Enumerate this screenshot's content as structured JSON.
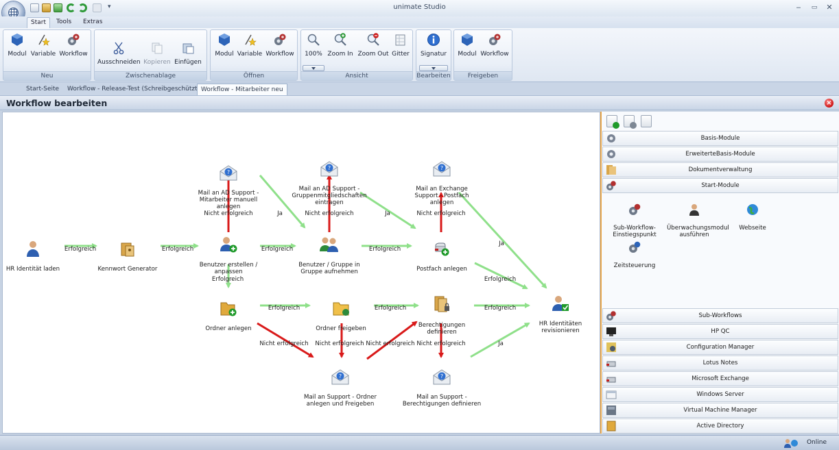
{
  "app": {
    "title": "unimate Studio",
    "window_controls": [
      "minimize-icon",
      "maximize-icon",
      "close-icon"
    ],
    "quick_access": [
      "new-icon",
      "open-icon",
      "save-icon",
      "undo-icon",
      "redo-icon",
      "disabled-icon",
      "customize-icon"
    ]
  },
  "menu": {
    "tabs": [
      "Start",
      "Tools",
      "Extras"
    ],
    "active": "Start"
  },
  "ribbon": {
    "groups": [
      {
        "label": "Neu",
        "buttons": [
          "Modul",
          "Variable",
          "Workflow"
        ]
      },
      {
        "label": "Zwischenablage",
        "buttons": [
          "Ausschneiden",
          "Kopieren",
          "Einfügen"
        ]
      },
      {
        "label": "Öffnen",
        "buttons": [
          "Modul",
          "Variable",
          "Workflow"
        ]
      },
      {
        "label": "Ansicht",
        "buttons": [
          "100%",
          "Zoom In",
          "Zoom Out",
          "Gitter"
        ]
      },
      {
        "label": "Bearbeiten",
        "buttons": [
          "Signatur"
        ]
      },
      {
        "label": "Freigeben",
        "buttons": [
          "Modul",
          "Workflow"
        ]
      }
    ]
  },
  "doc_tabs": {
    "items": [
      "Start-Seite",
      "Workflow - Release-Test (Schreibgeschützt)",
      "Workflow - Mitarbeiter neu"
    ],
    "active": 2
  },
  "panel": {
    "title": "Workflow bearbeiten"
  },
  "workflow": {
    "nodes": {
      "hr_laden": "HR Identität laden",
      "kennwort": "Kennwort Generator",
      "benutzer": "Benutzer erstellen /\nanpassen",
      "mail_ad1": "Mail an AD Support -\nMitarbeiter manuell anlegen",
      "gruppe": "Benutzer / Gruppe in\nGruppe aufnehmen",
      "mail_ad2": "Mail an AD Support -\nGruppenmitgliedschaften\neintragen",
      "postfach": "Postfach anlegen",
      "mail_exchange": "Mail an Exchange\nSupport - Postfach\nanlegen",
      "ordner": "Ordner anlegen",
      "ordner_frei": "Ordner freigeben",
      "berechtigungen": "Berechtigungen\ndefinieren",
      "mail_ordner": "Mail an Support - Ordner\nanlegen und Freigeben",
      "mail_berecht": "Mail an Support -\nBerechtigungen definieren",
      "hr_revision": "HR Identitäten\nrevisionieren"
    },
    "edge_labels": {
      "erfolgreich": "Erfolgreich",
      "nicht_erfolgreich": "Nicht erfolgreich",
      "ja": "Ja"
    },
    "colors": {
      "success": "#8fe08a",
      "failure": "#d91a1a"
    }
  },
  "right_panel": {
    "toolbar_icons": [
      "add-module-icon",
      "remove-module-icon",
      "document-icon"
    ],
    "categories_top": [
      "Basis-Module",
      "ErweiterteBasis-Module",
      "Dokumentverwaltung",
      "Start-Module"
    ],
    "start_modules": [
      "Sub-Workflow-\nEinstiegspunkt",
      "Überwachungsmodul\nausführen",
      "Webseite",
      "Zeitsteuerung"
    ],
    "categories_bottom": [
      "Sub-Workflows",
      "HP QC",
      "Configuration Manager",
      "Lotus Notes",
      "Microsoft Exchange",
      "Windows Server",
      "Virtual Machine Manager",
      "Active Directory"
    ],
    "accent": "#e8a64a"
  },
  "status": {
    "text": "Online"
  }
}
